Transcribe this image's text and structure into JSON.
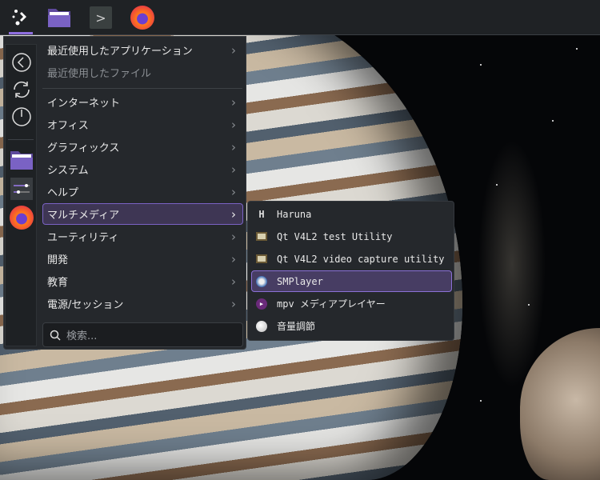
{
  "taskbar": {
    "items": [
      {
        "name": "application-launcher"
      },
      {
        "name": "file-manager"
      },
      {
        "name": "terminal"
      },
      {
        "name": "firefox"
      }
    ]
  },
  "menu": {
    "sidebar": [
      {
        "name": "back"
      },
      {
        "name": "refresh"
      },
      {
        "name": "power"
      },
      {
        "name": "file-manager"
      },
      {
        "name": "settings"
      },
      {
        "name": "firefox"
      }
    ],
    "items": [
      {
        "label": "最近使用したアプリケーション",
        "chevron": "›"
      },
      {
        "label": "最近使用したファイル"
      },
      {
        "label": "インターネット",
        "chevron": "›"
      },
      {
        "label": "オフィス",
        "chevron": "›"
      },
      {
        "label": "グラフィックス",
        "chevron": "›"
      },
      {
        "label": "システム",
        "chevron": "›"
      },
      {
        "label": "ヘルプ",
        "chevron": "›"
      },
      {
        "label": "マルチメディア",
        "chevron": "›"
      },
      {
        "label": "ユーティリティ",
        "chevron": "›"
      },
      {
        "label": "開発",
        "chevron": "›"
      },
      {
        "label": "教育",
        "chevron": "›"
      },
      {
        "label": "電源/セッション",
        "chevron": "›"
      }
    ],
    "search_placeholder": "検索..."
  },
  "submenu": {
    "items": [
      {
        "label": "Haruna"
      },
      {
        "label": "Qt V4L2 test Utility"
      },
      {
        "label": "Qt V4L2 video capture utility"
      },
      {
        "label": "SMPlayer"
      },
      {
        "label": "mpv メディアプレイヤー"
      },
      {
        "label": "音量調節"
      }
    ]
  },
  "colors": {
    "accent": "#8e6ee0",
    "panel": "#25282c",
    "taskbar": "#1f2225"
  }
}
